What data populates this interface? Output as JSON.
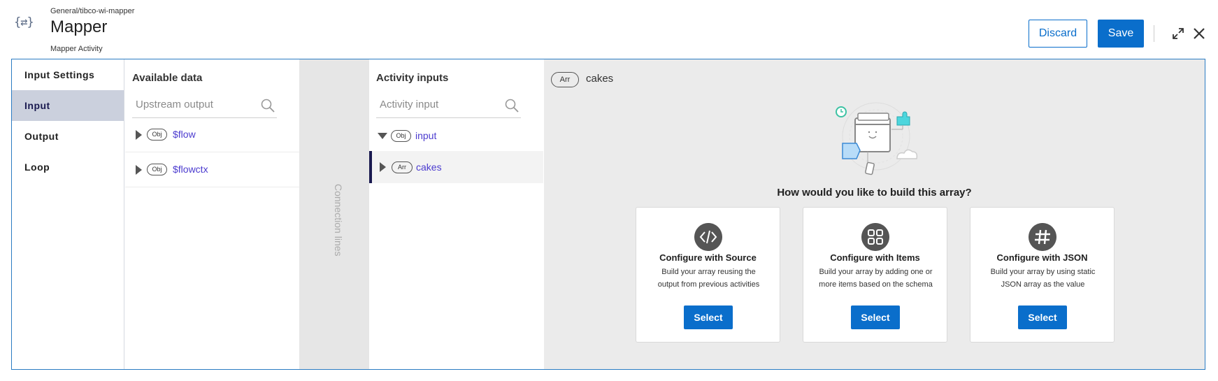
{
  "header": {
    "breadcrumb": "General/tibco-wi-mapper",
    "title": "Mapper",
    "subtitle": "Mapper Activity",
    "discard_label": "Discard",
    "save_label": "Save",
    "icons": {
      "app": "mapper-braces-icon",
      "expand": "expand-icon",
      "close": "close-icon"
    }
  },
  "colors": {
    "primary": "#0a6ecb",
    "link": "#4b3bcf",
    "active_nav": "#cbd0dd",
    "connection_bg": "#e6e6e6",
    "detail_bg": "#ebebeb"
  },
  "sidebar": {
    "items": [
      {
        "label": "Input Settings",
        "active": false
      },
      {
        "label": "Input",
        "active": true
      },
      {
        "label": "Output",
        "active": false
      },
      {
        "label": "Loop",
        "active": false
      }
    ]
  },
  "available": {
    "title": "Available data",
    "search_placeholder": "Upstream output",
    "items": [
      {
        "type": "Obj",
        "label": "$flow"
      },
      {
        "type": "Obj",
        "label": "$flowctx"
      }
    ]
  },
  "connection": {
    "label": "Connection lines"
  },
  "activity": {
    "title": "Activity inputs",
    "search_placeholder": "Activity input",
    "root": {
      "type": "Obj",
      "label": "input",
      "expanded": true
    },
    "children": [
      {
        "type": "Arr",
        "label": "cakes",
        "selected": true
      }
    ]
  },
  "detail": {
    "type": "Arr",
    "name": "cakes",
    "question": "How would you like to build this array?",
    "cards": [
      {
        "icon": "code-icon",
        "title": "Configure with Source",
        "desc": "Build your array reusing the output from previous activities",
        "button": "Select"
      },
      {
        "icon": "grid-icon",
        "title": "Configure with Items",
        "desc": "Build your array by adding one or more items based on the schema",
        "button": "Select"
      },
      {
        "icon": "hash-icon",
        "title": "Configure with JSON",
        "desc": "Build your array by using static JSON array as the value",
        "button": "Select"
      }
    ]
  }
}
